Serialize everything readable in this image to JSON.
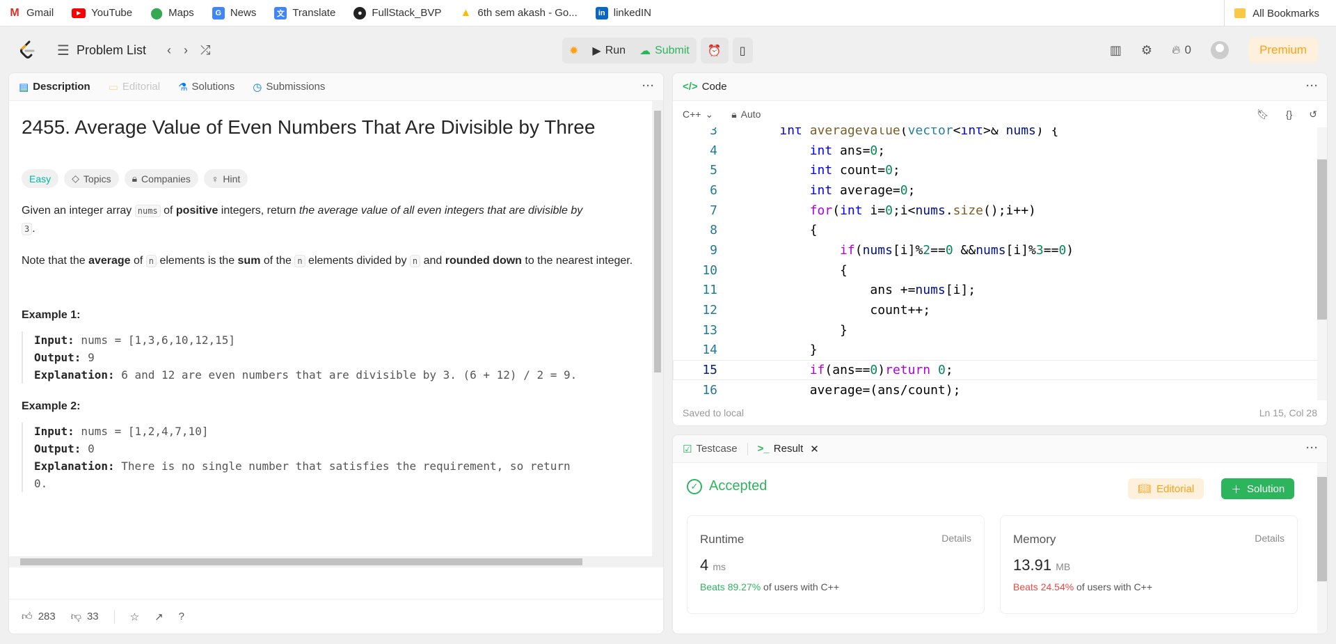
{
  "bookmarks": {
    "items": [
      {
        "label": "Gmail",
        "icon": "gmail-icon"
      },
      {
        "label": "YouTube",
        "icon": "youtube-icon"
      },
      {
        "label": "Maps",
        "icon": "maps-icon"
      },
      {
        "label": "News",
        "icon": "news-icon"
      },
      {
        "label": "Translate",
        "icon": "translate-icon"
      },
      {
        "label": "FullStack_BVP",
        "icon": "github-icon"
      },
      {
        "label": "6th sem akash - Go...",
        "icon": "drive-icon"
      },
      {
        "label": "linkedIN",
        "icon": "linkedin-icon"
      }
    ],
    "all_label": "All Bookmarks"
  },
  "nav": {
    "problem_list": "Problem List",
    "run": "Run",
    "submit": "Submit",
    "streak": "0",
    "premium": "Premium"
  },
  "left_tabs": {
    "description": "Description",
    "editorial": "Editorial",
    "solutions": "Solutions",
    "submissions": "Submissions"
  },
  "problem": {
    "title": "2455. Average Value of Even Numbers That Are Divisible by Three",
    "tags": {
      "difficulty": "Easy",
      "topics": "Topics",
      "companies": "Companies",
      "hint": "Hint"
    },
    "p1_a": "Given an integer array ",
    "p1_code": "nums",
    "p1_b": " of ",
    "p1_bold": "positive",
    "p1_c": " integers, return ",
    "p1_italic": "the average value of all even integers that are divisible by",
    "p1_code2": "3",
    "p1_end": ".",
    "p2_a": "Note that the ",
    "p2_b1": "average",
    "p2_b": " of ",
    "p2_code1": "n",
    "p2_c": " elements is the ",
    "p2_b2": "sum",
    "p2_d": " of the ",
    "p2_code2": "n",
    "p2_e": " elements divided by ",
    "p2_code3": "n",
    "p2_f": " and ",
    "p2_b3": "rounded down",
    "p2_g": " to the nearest integer.",
    "ex1_title": "Example 1:",
    "ex1_input_label": "Input:",
    "ex1_input": " nums = [1,3,6,10,12,15]",
    "ex1_output_label": "Output:",
    "ex1_output": " 9",
    "ex1_expl_label": "Explanation:",
    "ex1_expl": " 6 and 12 are even numbers that are divisible by 3. (6 + 12) / 2 = 9.",
    "ex2_title": "Example 2:",
    "ex2_input_label": "Input:",
    "ex2_input": " nums = [1,2,4,7,10]",
    "ex2_output_label": "Output:",
    "ex2_output": " 0",
    "ex2_expl_label": "Explanation:",
    "ex2_expl": " There is no single number that satisfies the requirement, so return",
    "ex2_expl2": "0."
  },
  "footer": {
    "likes": "283",
    "dislikes": "33"
  },
  "code_panel": {
    "title": "Code",
    "language": "C++",
    "mode": "Auto",
    "saved": "Saved to local",
    "cursor": "Ln 15, Col 28",
    "line_numbers": [
      "3",
      "4",
      "5",
      "6",
      "7",
      "8",
      "9",
      "10",
      "11",
      "12",
      "13",
      "14",
      "15",
      "16"
    ]
  },
  "result_panel": {
    "tab_testcase": "Testcase",
    "tab_result": "Result",
    "status": "Accepted",
    "editorial_btn": "Editorial",
    "solution_btn": "Solution",
    "runtime": {
      "label": "Runtime",
      "details": "Details",
      "value": "4",
      "unit": "ms",
      "beats": "Beats 89.27%",
      "suffix": " of users with C++"
    },
    "memory": {
      "label": "Memory",
      "details": "Details",
      "value": "13.91",
      "unit": "MB",
      "beats": "Beats 24.54%",
      "suffix": " of users with C++"
    }
  },
  "colors": {
    "accent": "#ffa116",
    "success": "#2db55d",
    "danger": "#ef4743",
    "easy": "#00b8a3"
  }
}
